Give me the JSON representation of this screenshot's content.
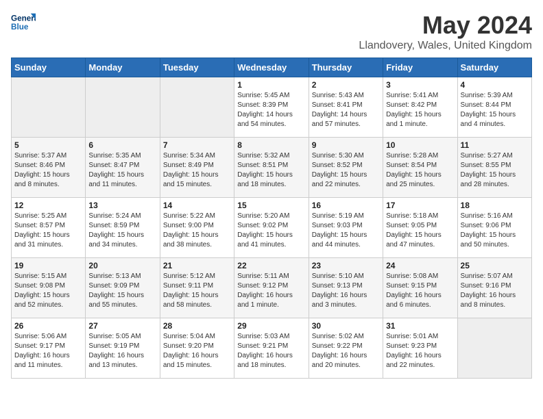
{
  "logo": {
    "line1": "General",
    "line2": "Blue"
  },
  "title": "May 2024",
  "subtitle": "Llandovery, Wales, United Kingdom",
  "headers": [
    "Sunday",
    "Monday",
    "Tuesday",
    "Wednesday",
    "Thursday",
    "Friday",
    "Saturday"
  ],
  "weeks": [
    [
      {
        "day": "",
        "info": ""
      },
      {
        "day": "",
        "info": ""
      },
      {
        "day": "",
        "info": ""
      },
      {
        "day": "1",
        "info": "Sunrise: 5:45 AM\nSunset: 8:39 PM\nDaylight: 14 hours\nand 54 minutes."
      },
      {
        "day": "2",
        "info": "Sunrise: 5:43 AM\nSunset: 8:41 PM\nDaylight: 14 hours\nand 57 minutes."
      },
      {
        "day": "3",
        "info": "Sunrise: 5:41 AM\nSunset: 8:42 PM\nDaylight: 15 hours\nand 1 minute."
      },
      {
        "day": "4",
        "info": "Sunrise: 5:39 AM\nSunset: 8:44 PM\nDaylight: 15 hours\nand 4 minutes."
      }
    ],
    [
      {
        "day": "5",
        "info": "Sunrise: 5:37 AM\nSunset: 8:46 PM\nDaylight: 15 hours\nand 8 minutes."
      },
      {
        "day": "6",
        "info": "Sunrise: 5:35 AM\nSunset: 8:47 PM\nDaylight: 15 hours\nand 11 minutes."
      },
      {
        "day": "7",
        "info": "Sunrise: 5:34 AM\nSunset: 8:49 PM\nDaylight: 15 hours\nand 15 minutes."
      },
      {
        "day": "8",
        "info": "Sunrise: 5:32 AM\nSunset: 8:51 PM\nDaylight: 15 hours\nand 18 minutes."
      },
      {
        "day": "9",
        "info": "Sunrise: 5:30 AM\nSunset: 8:52 PM\nDaylight: 15 hours\nand 22 minutes."
      },
      {
        "day": "10",
        "info": "Sunrise: 5:28 AM\nSunset: 8:54 PM\nDaylight: 15 hours\nand 25 minutes."
      },
      {
        "day": "11",
        "info": "Sunrise: 5:27 AM\nSunset: 8:55 PM\nDaylight: 15 hours\nand 28 minutes."
      }
    ],
    [
      {
        "day": "12",
        "info": "Sunrise: 5:25 AM\nSunset: 8:57 PM\nDaylight: 15 hours\nand 31 minutes."
      },
      {
        "day": "13",
        "info": "Sunrise: 5:24 AM\nSunset: 8:59 PM\nDaylight: 15 hours\nand 34 minutes."
      },
      {
        "day": "14",
        "info": "Sunrise: 5:22 AM\nSunset: 9:00 PM\nDaylight: 15 hours\nand 38 minutes."
      },
      {
        "day": "15",
        "info": "Sunrise: 5:20 AM\nSunset: 9:02 PM\nDaylight: 15 hours\nand 41 minutes."
      },
      {
        "day": "16",
        "info": "Sunrise: 5:19 AM\nSunset: 9:03 PM\nDaylight: 15 hours\nand 44 minutes."
      },
      {
        "day": "17",
        "info": "Sunrise: 5:18 AM\nSunset: 9:05 PM\nDaylight: 15 hours\nand 47 minutes."
      },
      {
        "day": "18",
        "info": "Sunrise: 5:16 AM\nSunset: 9:06 PM\nDaylight: 15 hours\nand 50 minutes."
      }
    ],
    [
      {
        "day": "19",
        "info": "Sunrise: 5:15 AM\nSunset: 9:08 PM\nDaylight: 15 hours\nand 52 minutes."
      },
      {
        "day": "20",
        "info": "Sunrise: 5:13 AM\nSunset: 9:09 PM\nDaylight: 15 hours\nand 55 minutes."
      },
      {
        "day": "21",
        "info": "Sunrise: 5:12 AM\nSunset: 9:11 PM\nDaylight: 15 hours\nand 58 minutes."
      },
      {
        "day": "22",
        "info": "Sunrise: 5:11 AM\nSunset: 9:12 PM\nDaylight: 16 hours\nand 1 minute."
      },
      {
        "day": "23",
        "info": "Sunrise: 5:10 AM\nSunset: 9:13 PM\nDaylight: 16 hours\nand 3 minutes."
      },
      {
        "day": "24",
        "info": "Sunrise: 5:08 AM\nSunset: 9:15 PM\nDaylight: 16 hours\nand 6 minutes."
      },
      {
        "day": "25",
        "info": "Sunrise: 5:07 AM\nSunset: 9:16 PM\nDaylight: 16 hours\nand 8 minutes."
      }
    ],
    [
      {
        "day": "26",
        "info": "Sunrise: 5:06 AM\nSunset: 9:17 PM\nDaylight: 16 hours\nand 11 minutes."
      },
      {
        "day": "27",
        "info": "Sunrise: 5:05 AM\nSunset: 9:19 PM\nDaylight: 16 hours\nand 13 minutes."
      },
      {
        "day": "28",
        "info": "Sunrise: 5:04 AM\nSunset: 9:20 PM\nDaylight: 16 hours\nand 15 minutes."
      },
      {
        "day": "29",
        "info": "Sunrise: 5:03 AM\nSunset: 9:21 PM\nDaylight: 16 hours\nand 18 minutes."
      },
      {
        "day": "30",
        "info": "Sunrise: 5:02 AM\nSunset: 9:22 PM\nDaylight: 16 hours\nand 20 minutes."
      },
      {
        "day": "31",
        "info": "Sunrise: 5:01 AM\nSunset: 9:23 PM\nDaylight: 16 hours\nand 22 minutes."
      },
      {
        "day": "",
        "info": ""
      }
    ]
  ]
}
